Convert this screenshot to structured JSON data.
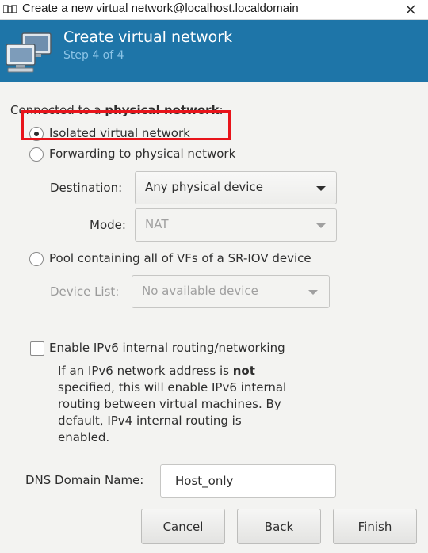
{
  "window": {
    "title": "Create a new virtual network@localhost.localdomain",
    "app_icon": "virt-manager-icon",
    "close_icon": "close-icon"
  },
  "header": {
    "title": "Create virtual network",
    "subtitle": "Step 4 of 4",
    "icon": "network-computers-icon",
    "background": "#1e75a8",
    "subtitle_color": "#8cc4e6"
  },
  "connection": {
    "label_prefix": "Connected to a ",
    "label_bold": "physical network",
    "label_suffix": ":",
    "options": {
      "isolated": "Isolated virtual network",
      "forwarding": "Forwarding to physical network",
      "sriov": "Pool containing all of VFs of a SR-IOV device"
    },
    "selected": "isolated"
  },
  "forwarding": {
    "destination_label": "Destination:",
    "destination_value": "Any physical device",
    "mode_label": "Mode:",
    "mode_value": "NAT"
  },
  "sriov": {
    "device_list_label": "Device List:",
    "device_list_value": "No available device"
  },
  "ipv6": {
    "checkbox_label": "Enable IPv6 internal routing/networking",
    "checked": false,
    "note_part1": "If an IPv6 network address is ",
    "note_bold": "not",
    "note_part2": " specified, this will enable IPv6 internal routing between virtual machines.  By default, IPv4 internal routing is enabled."
  },
  "dns": {
    "label": "DNS Domain Name:",
    "value": "Host_only"
  },
  "buttons": {
    "cancel": "Cancel",
    "back": "Back",
    "finish": "Finish"
  },
  "annotation": {
    "highlight_color": "#e8141b",
    "highlight_target": "isolated-radio-option"
  }
}
